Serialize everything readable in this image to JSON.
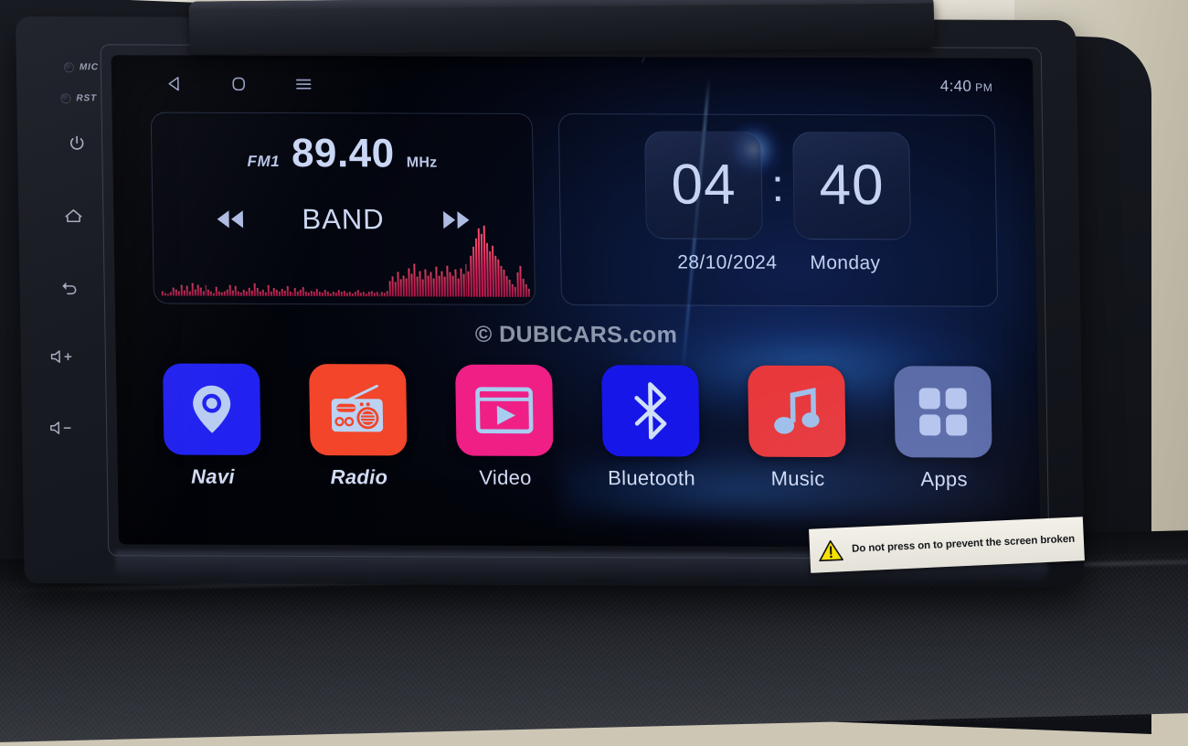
{
  "statusbar": {
    "nav_back": "back-triangle-icon",
    "nav_home": "home-square-icon",
    "nav_menu": "hamburger-menu-icon",
    "time": "4:40",
    "ampm": "PM"
  },
  "radio_widget": {
    "band_tag": "FM1",
    "frequency": "89.40",
    "unit": "MHz",
    "band_button": "BAND",
    "prev_icon": "rewind-icon",
    "next_icon": "fast-forward-icon",
    "spectrum": [
      6,
      4,
      3,
      5,
      12,
      9,
      7,
      16,
      8,
      14,
      6,
      18,
      9,
      16,
      11,
      7,
      15,
      9,
      6,
      4,
      13,
      6,
      5,
      7,
      9,
      16,
      8,
      14,
      7,
      5,
      9,
      6,
      11,
      8,
      18,
      12,
      7,
      9,
      5,
      15,
      7,
      12,
      9,
      6,
      10,
      8,
      14,
      7,
      5,
      11,
      6,
      9,
      13,
      7,
      5,
      8,
      6,
      10,
      7,
      5,
      9,
      6,
      4,
      7,
      5,
      9,
      6,
      8,
      5,
      7,
      4,
      6,
      9,
      5,
      7,
      4,
      6,
      8,
      5,
      7,
      4,
      6,
      5,
      8,
      22,
      28,
      20,
      34,
      24,
      30,
      26,
      40,
      32,
      46,
      28,
      36,
      24,
      38,
      30,
      34,
      26,
      42,
      30,
      36,
      28,
      44,
      34,
      30,
      38,
      26,
      40,
      32,
      46,
      36,
      58,
      70,
      82,
      96,
      88,
      100,
      76,
      64,
      72,
      58,
      52,
      44,
      38,
      30,
      24,
      18,
      14,
      34,
      44,
      26,
      18,
      12
    ]
  },
  "clock_widget": {
    "hours": "04",
    "colon": ":",
    "minutes": "40",
    "date": "28/10/2024",
    "day": "Monday"
  },
  "watermark": "© DUBICARS.com",
  "dock": {
    "apps": [
      {
        "label": "Navi",
        "icon": "location-pin-icon",
        "tile_color": "#2222f0",
        "glyph_color": "#b9cdf2",
        "italic": true
      },
      {
        "label": "Radio",
        "icon": "radio-set-icon",
        "tile_color": "#f2452a",
        "glyph_color": "#bcd2f2",
        "italic": true
      },
      {
        "label": "Video",
        "icon": "video-player-icon",
        "tile_color": "#ef1f86",
        "glyph_color": "#a8cdf0",
        "italic": false
      },
      {
        "label": "Bluetooth",
        "icon": "bluetooth-icon",
        "tile_color": "#1616e8",
        "glyph_color": "#cfe0f8",
        "italic": false
      },
      {
        "label": "Music",
        "icon": "music-note-icon",
        "tile_color": "#e8383c",
        "glyph_color": "#9fc0ea",
        "italic": false
      },
      {
        "label": "Apps",
        "icon": "app-grid-icon",
        "tile_color": "#5b6ba8",
        "glyph_color": "#b6c6ee",
        "italic": false
      }
    ]
  },
  "hardware": {
    "mic_label": "MIC",
    "rst_label": "RST",
    "power_icon": "power-icon",
    "home_icon": "home-outline-icon",
    "back_icon": "back-arrow-icon",
    "vol_up_icon": "volume-up-icon",
    "vol_down_icon": "volume-down-icon"
  },
  "sticker": {
    "warning_icon": "warning-triangle-icon",
    "text": "Do not press on to prevent the screen broken"
  },
  "colors": {
    "screen_bg": "#05060b",
    "accent_blue": "#c3cdea",
    "spectrum": "#e8245e"
  }
}
